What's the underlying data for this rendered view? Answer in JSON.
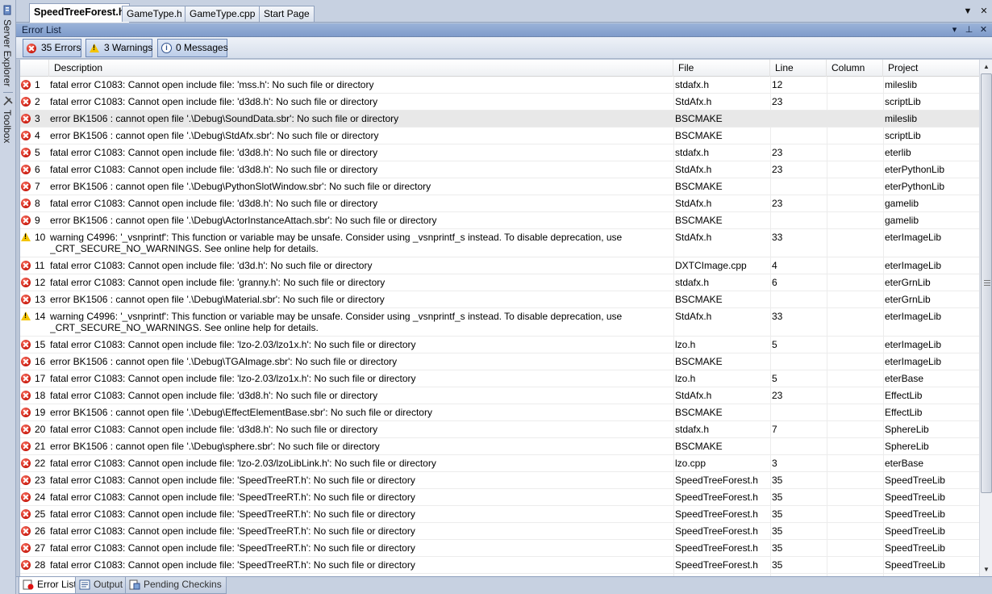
{
  "side_panels": [
    "Server Explorer",
    "Toolbox"
  ],
  "document_tabs": [
    {
      "label": "SpeedTreeForest.h",
      "active": true
    },
    {
      "label": "GameType.h",
      "active": false
    },
    {
      "label": "GameType.cpp",
      "active": false
    },
    {
      "label": "Start Page",
      "active": false
    }
  ],
  "tool_window": {
    "title": "Error List"
  },
  "filters": {
    "errors": "35 Errors",
    "warnings": "3 Warnings",
    "messages": "0 Messages"
  },
  "columns": {
    "description": "Description",
    "file": "File",
    "line": "Line",
    "column": "Column",
    "project": "Project"
  },
  "rows": [
    {
      "type": "error",
      "num": "1",
      "desc": "fatal error C1083: Cannot open include file: 'mss.h': No such file or directory",
      "file": "stdafx.h",
      "line": "12",
      "col": "",
      "project": "mileslib"
    },
    {
      "type": "error",
      "num": "2",
      "desc": "fatal error C1083: Cannot open include file: 'd3d8.h': No such file or directory",
      "file": "StdAfx.h",
      "line": "23",
      "col": "",
      "project": "scriptLib"
    },
    {
      "type": "error",
      "num": "3",
      "desc": "error BK1506 : cannot open file '.\\Debug\\SoundData.sbr': No such file or directory",
      "file": "BSCMAKE",
      "line": "",
      "col": "",
      "project": "mileslib",
      "selected": true
    },
    {
      "type": "error",
      "num": "4",
      "desc": "error BK1506 : cannot open file '.\\Debug\\StdAfx.sbr': No such file or directory",
      "file": "BSCMAKE",
      "line": "",
      "col": "",
      "project": "scriptLib"
    },
    {
      "type": "error",
      "num": "5",
      "desc": "fatal error C1083: Cannot open include file: 'd3d8.h': No such file or directory",
      "file": "stdafx.h",
      "line": "23",
      "col": "",
      "project": "eterlib"
    },
    {
      "type": "error",
      "num": "6",
      "desc": "fatal error C1083: Cannot open include file: 'd3d8.h': No such file or directory",
      "file": "StdAfx.h",
      "line": "23",
      "col": "",
      "project": "eterPythonLib"
    },
    {
      "type": "error",
      "num": "7",
      "desc": "error BK1506 : cannot open file '.\\Debug\\PythonSlotWindow.sbr': No such file or directory",
      "file": "BSCMAKE",
      "line": "",
      "col": "",
      "project": "eterPythonLib"
    },
    {
      "type": "error",
      "num": "8",
      "desc": "fatal error C1083: Cannot open include file: 'd3d8.h': No such file or directory",
      "file": "StdAfx.h",
      "line": "23",
      "col": "",
      "project": "gamelib"
    },
    {
      "type": "error",
      "num": "9",
      "desc": "error BK1506 : cannot open file '.\\Debug\\ActorInstanceAttach.sbr': No such file or directory",
      "file": "BSCMAKE",
      "line": "",
      "col": "",
      "project": "gamelib"
    },
    {
      "type": "warning",
      "num": "10",
      "desc": "warning C4996: '_vsnprintf': This function or variable may be unsafe. Consider using _vsnprintf_s instead. To disable deprecation, use _CRT_SECURE_NO_WARNINGS. See online help for details.",
      "file": "StdAfx.h",
      "line": "33",
      "col": "",
      "project": "eterImageLib"
    },
    {
      "type": "error",
      "num": "11",
      "desc": "fatal error C1083: Cannot open include file: 'd3d.h': No such file or directory",
      "file": "DXTCImage.cpp",
      "line": "4",
      "col": "",
      "project": "eterImageLib"
    },
    {
      "type": "error",
      "num": "12",
      "desc": "fatal error C1083: Cannot open include file: 'granny.h': No such file or directory",
      "file": "stdafx.h",
      "line": "6",
      "col": "",
      "project": "eterGrnLib"
    },
    {
      "type": "error",
      "num": "13",
      "desc": "error BK1506 : cannot open file '.\\Debug\\Material.sbr': No such file or directory",
      "file": "BSCMAKE",
      "line": "",
      "col": "",
      "project": "eterGrnLib"
    },
    {
      "type": "warning",
      "num": "14",
      "desc": "warning C4996: '_vsnprintf': This function or variable may be unsafe. Consider using _vsnprintf_s instead. To disable deprecation, use _CRT_SECURE_NO_WARNINGS. See online help for details.",
      "file": "StdAfx.h",
      "line": "33",
      "col": "",
      "project": "eterImageLib"
    },
    {
      "type": "error",
      "num": "15",
      "desc": "fatal error C1083: Cannot open include file: 'lzo-2.03/lzo1x.h': No such file or directory",
      "file": "lzo.h",
      "line": "5",
      "col": "",
      "project": "eterImageLib"
    },
    {
      "type": "error",
      "num": "16",
      "desc": "error BK1506 : cannot open file '.\\Debug\\TGAImage.sbr': No such file or directory",
      "file": "BSCMAKE",
      "line": "",
      "col": "",
      "project": "eterImageLib"
    },
    {
      "type": "error",
      "num": "17",
      "desc": "fatal error C1083: Cannot open include file: 'lzo-2.03/lzo1x.h': No such file or directory",
      "file": "lzo.h",
      "line": "5",
      "col": "",
      "project": "eterBase"
    },
    {
      "type": "error",
      "num": "18",
      "desc": "fatal error C1083: Cannot open include file: 'd3d8.h': No such file or directory",
      "file": "StdAfx.h",
      "line": "23",
      "col": "",
      "project": "EffectLib"
    },
    {
      "type": "error",
      "num": "19",
      "desc": "error BK1506 : cannot open file '.\\Debug\\EffectElementBase.sbr': No such file or directory",
      "file": "BSCMAKE",
      "line": "",
      "col": "",
      "project": "EffectLib"
    },
    {
      "type": "error",
      "num": "20",
      "desc": "fatal error C1083: Cannot open include file: 'd3d8.h': No such file or directory",
      "file": "stdafx.h",
      "line": "7",
      "col": "",
      "project": "SphereLib"
    },
    {
      "type": "error",
      "num": "21",
      "desc": "error BK1506 : cannot open file '.\\Debug\\sphere.sbr': No such file or directory",
      "file": "BSCMAKE",
      "line": "",
      "col": "",
      "project": "SphereLib"
    },
    {
      "type": "error",
      "num": "22",
      "desc": "fatal error C1083: Cannot open include file: 'lzo-2.03/lzoLibLink.h': No such file or directory",
      "file": "lzo.cpp",
      "line": "3",
      "col": "",
      "project": "eterBase"
    },
    {
      "type": "error",
      "num": "23",
      "desc": "fatal error C1083: Cannot open include file: 'SpeedTreeRT.h': No such file or directory",
      "file": "SpeedTreeForest.h",
      "line": "35",
      "col": "",
      "project": "SpeedTreeLib"
    },
    {
      "type": "error",
      "num": "24",
      "desc": "fatal error C1083: Cannot open include file: 'SpeedTreeRT.h': No such file or directory",
      "file": "SpeedTreeForest.h",
      "line": "35",
      "col": "",
      "project": "SpeedTreeLib"
    },
    {
      "type": "error",
      "num": "25",
      "desc": "fatal error C1083: Cannot open include file: 'SpeedTreeRT.h': No such file or directory",
      "file": "SpeedTreeForest.h",
      "line": "35",
      "col": "",
      "project": "SpeedTreeLib"
    },
    {
      "type": "error",
      "num": "26",
      "desc": "fatal error C1083: Cannot open include file: 'SpeedTreeRT.h': No such file or directory",
      "file": "SpeedTreeForest.h",
      "line": "35",
      "col": "",
      "project": "SpeedTreeLib"
    },
    {
      "type": "error",
      "num": "27",
      "desc": "fatal error C1083: Cannot open include file: 'SpeedTreeRT.h': No such file or directory",
      "file": "SpeedTreeForest.h",
      "line": "35",
      "col": "",
      "project": "SpeedTreeLib"
    },
    {
      "type": "error",
      "num": "28",
      "desc": "fatal error C1083: Cannot open include file: 'SpeedTreeRT.h': No such file or directory",
      "file": "SpeedTreeForest.h",
      "line": "35",
      "col": "",
      "project": "SpeedTreeLib"
    }
  ],
  "bottom_tabs": [
    {
      "label": "Error List",
      "active": true,
      "icon": "error-list-icon"
    },
    {
      "label": "Output",
      "active": false,
      "icon": "output-icon"
    },
    {
      "label": "Pending Checkins",
      "active": false,
      "icon": "pending-checkins-icon"
    }
  ]
}
